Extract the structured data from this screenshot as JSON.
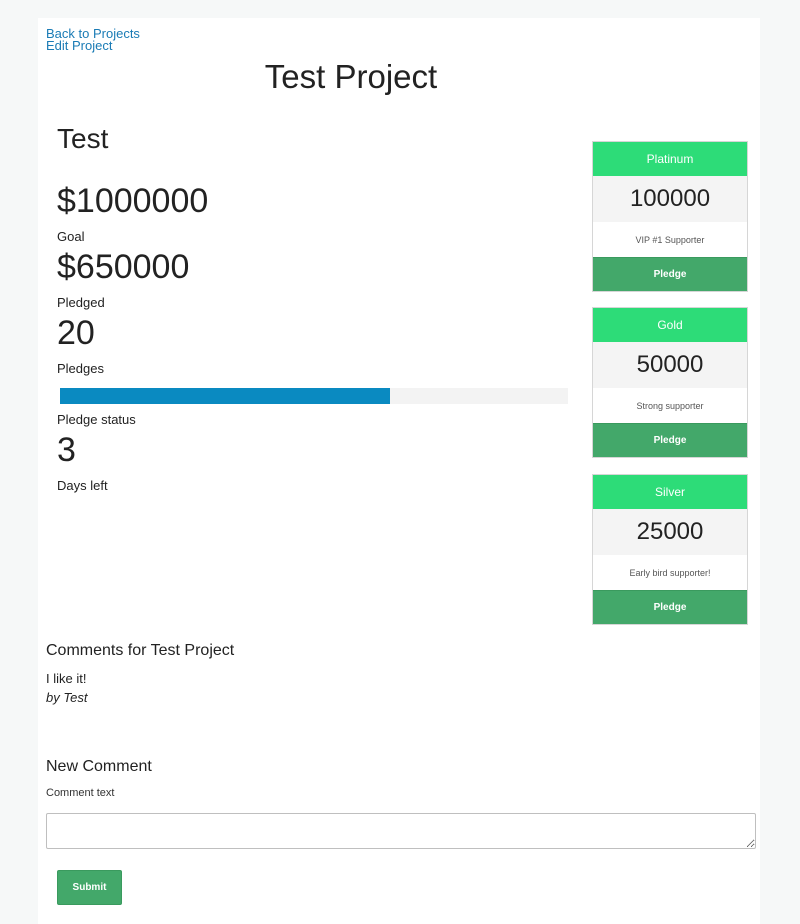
{
  "nav": {
    "back_label": "Back to Projects",
    "edit_label": "Edit Project"
  },
  "project": {
    "title": "Test Project",
    "name": "Test"
  },
  "stats": {
    "goal_value": "$1000000",
    "goal_label": "Goal",
    "pledged_value": "$650000",
    "pledged_label": "Pledged",
    "pledges_value": "20",
    "pledges_label": "Pledges",
    "status_label": "Pledge status",
    "progress_fraction": 0.65,
    "days_value": "3",
    "days_label": "Days left"
  },
  "rewards": [
    {
      "name": "Platinum",
      "amount": "100000",
      "description": "VIP #1 Supporter",
      "button": "Pledge"
    },
    {
      "name": "Gold",
      "amount": "50000",
      "description": "Strong supporter",
      "button": "Pledge"
    },
    {
      "name": "Silver",
      "amount": "25000",
      "description": "Early bird supporter!",
      "button": "Pledge"
    }
  ],
  "comments": {
    "heading": "Comments for Test Project",
    "items": [
      {
        "text": "I like it!",
        "author": "by Test"
      }
    ]
  },
  "new_comment": {
    "heading": "New Comment",
    "field_label": "Comment text",
    "value": "",
    "submit_label": "Submit"
  },
  "colors": {
    "link": "#1a7bb5",
    "reward_header": "#2ddc78",
    "pledge_button": "#43a86a",
    "progress": "#0a8ac1"
  }
}
